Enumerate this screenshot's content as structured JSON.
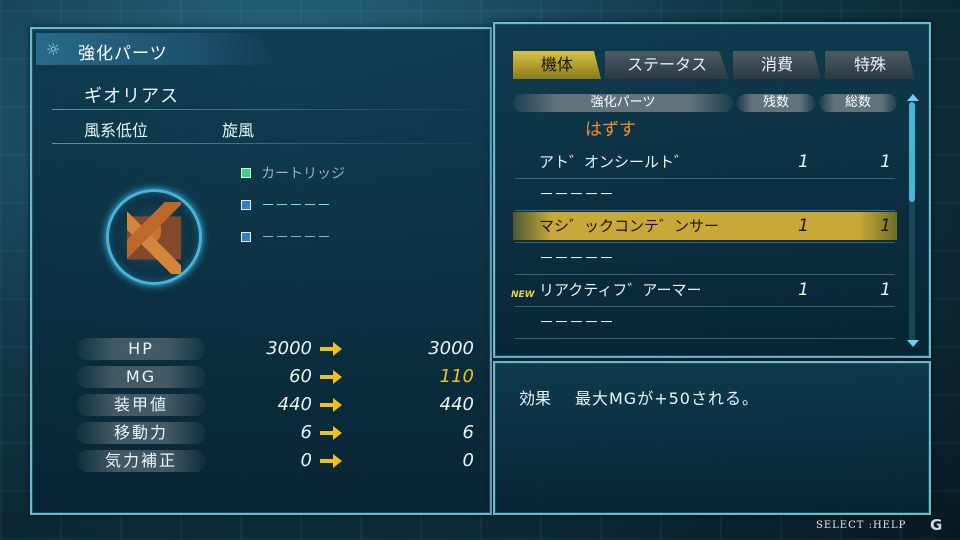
{
  "left": {
    "header": "強化パーツ",
    "unit_name": "ギオリアス",
    "unit_type": "風系低位",
    "unit_element": "旋風",
    "slots": [
      {
        "label": "カートリッジ",
        "icon": "green-square-icon"
      },
      {
        "label": "－－－－－",
        "icon": "blue-square-icon"
      },
      {
        "label": "－－－－－",
        "icon": "blue-square-icon"
      }
    ],
    "stats": [
      {
        "label": "HP",
        "current": "3000",
        "new": "3000"
      },
      {
        "label": "MG",
        "current": "60",
        "new": "110"
      },
      {
        "label": "装甲値",
        "current": "440",
        "new": "440"
      },
      {
        "label": "移動力",
        "current": "6",
        "new": "6"
      },
      {
        "label": "気力補正",
        "current": "0",
        "new": "0"
      }
    ]
  },
  "right": {
    "tabs": [
      "機体",
      "ステータス",
      "消費",
      "特殊"
    ],
    "columns": {
      "name": "強化パーツ",
      "remaining": "残数",
      "total": "総数"
    },
    "remove_label": "はずす",
    "new_badge": "NEW",
    "items": [
      {
        "name": "アト゛オンシールト゛",
        "remaining": "1",
        "total": "1"
      },
      {
        "name": "－－－－－",
        "remaining": "",
        "total": ""
      },
      {
        "name": "マシ゛ックコンテ゛ンサー",
        "remaining": "1",
        "total": "1"
      },
      {
        "name": "－－－－－",
        "remaining": "",
        "total": ""
      },
      {
        "name": "リアクティフ゛アーマー",
        "remaining": "1",
        "total": "1"
      },
      {
        "name": "－－－－－",
        "remaining": "",
        "total": ""
      }
    ]
  },
  "effect": {
    "label": "効果",
    "text": "最大MGが+50される。"
  },
  "footer": {
    "hint": "SELECT  :HELP",
    "logo": "G"
  },
  "colors": {
    "accent_gold": "#c8a838",
    "increase": "#f0c020",
    "remove": "#f0902a",
    "frame": "#6fb8cc"
  }
}
